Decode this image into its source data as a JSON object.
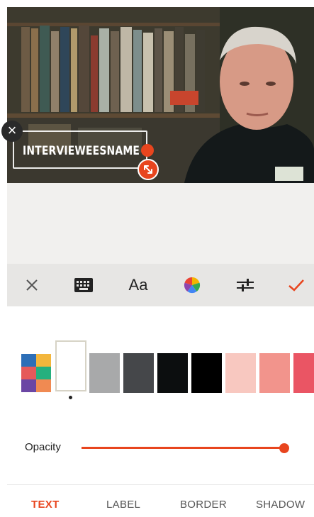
{
  "editor": {
    "text_label": "INTERVIEWEESNAME",
    "close_glyph": "×"
  },
  "toolbar": {
    "items": [
      {
        "icon": "close-icon",
        "glyph": "✕"
      },
      {
        "icon": "keyboard-icon"
      },
      {
        "label": "Aa"
      },
      {
        "icon": "color-wheel-icon"
      },
      {
        "icon": "adjust-sliders-icon"
      },
      {
        "icon": "checkmark-icon",
        "glyph": "✓"
      }
    ]
  },
  "colors": {
    "accent": "#e8451e",
    "swatches": [
      "multicolor",
      "#ffffff",
      "#a8a9aa",
      "#45474a",
      "#0c0e0f",
      "#000000",
      "#f8c8c0",
      "#f2948c",
      "#ea5564"
    ],
    "selected_index": 1
  },
  "opacity": {
    "label": "Opacity",
    "value": 1.0
  },
  "tabs": [
    {
      "label": "TEXT",
      "active": true
    },
    {
      "label": "LABEL",
      "active": false
    },
    {
      "label": "BORDER",
      "active": false
    },
    {
      "label": "SHADOW",
      "active": false
    }
  ]
}
